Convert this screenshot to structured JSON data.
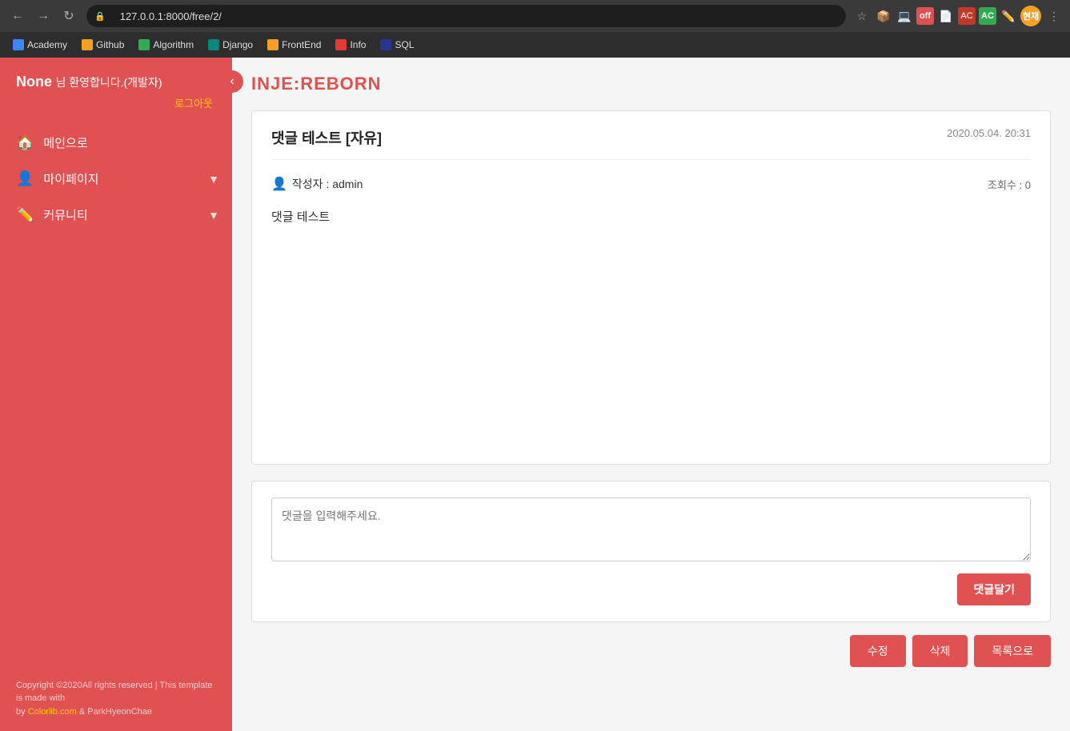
{
  "browser": {
    "address": "127.0.0.1:8000/free/2/",
    "bookmarks": [
      {
        "label": "Academy",
        "color": "bm-blue"
      },
      {
        "label": "Github",
        "color": "bm-orange"
      },
      {
        "label": "Algorithm",
        "color": "bm-green"
      },
      {
        "label": "Django",
        "color": "bm-teal"
      },
      {
        "label": "FrontEnd",
        "color": "bm-orange"
      },
      {
        "label": "Info",
        "color": "bm-red"
      },
      {
        "label": "SQL",
        "color": "bm-navy"
      }
    ]
  },
  "sidebar": {
    "username": "None",
    "welcome": "님 환영합니다.(개발자)",
    "logout": "로그아웃",
    "nav": [
      {
        "label": "메인으로",
        "icon": "🏠",
        "arrow": false
      },
      {
        "label": "마이페이지",
        "icon": "👤",
        "arrow": true
      },
      {
        "label": "커뮤니티",
        "icon": "✏️",
        "arrow": true
      }
    ],
    "footer": "Copyright ©2020All rights reserved | This template is made with",
    "footer_link_text": "Colorlib.com",
    "footer_author": " & ParkHyeonChae"
  },
  "site": {
    "logo": "INJE:REBORN"
  },
  "post": {
    "title": "댓글 테스트",
    "category": "[자유]",
    "date": "2020.05.04. 20:31",
    "author_label": "작성자 : admin",
    "views_label": "조회수 : 0",
    "body": "댓글 테스트"
  },
  "comment": {
    "placeholder": "댓글을 입력해주세요.",
    "submit_label": "댓글달기"
  },
  "actions": {
    "edit": "수정",
    "delete": "삭제",
    "list": "목록으로"
  }
}
